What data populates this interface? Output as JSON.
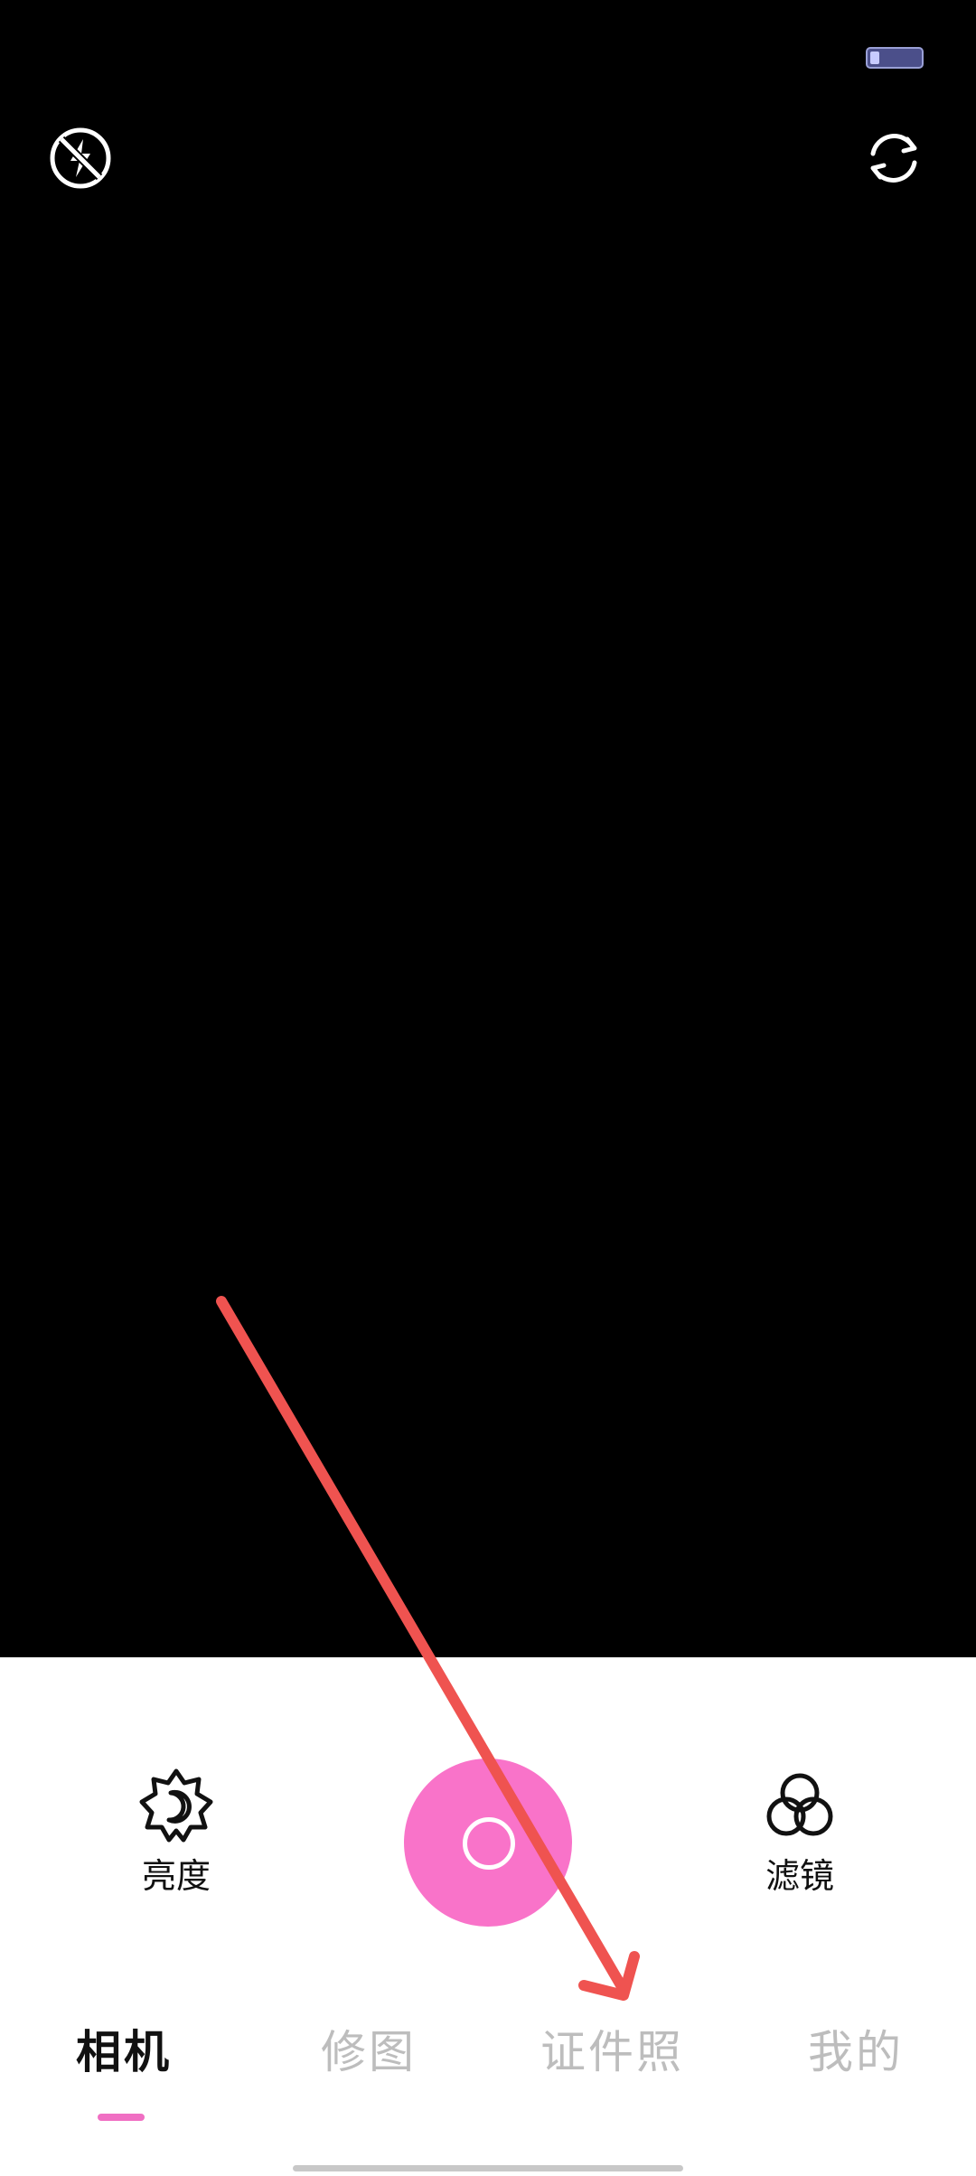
{
  "status_bar": {
    "battery_icon": "battery-icon"
  },
  "camera_top": {
    "flash_icon": "flash-off-icon",
    "switch_icon": "camera-switch-icon"
  },
  "tools": {
    "brightness": {
      "label": "亮度",
      "icon": "brightness-icon"
    },
    "filter": {
      "label": "滤镜",
      "icon": "filter-icon"
    }
  },
  "shutter": {
    "icon": "shutter-button",
    "color": "#f973c9"
  },
  "tabs": [
    {
      "label": "相机",
      "active": true
    },
    {
      "label": "修图",
      "active": false
    },
    {
      "label": "证件照",
      "active": false
    },
    {
      "label": "我的",
      "active": false
    }
  ],
  "colors": {
    "accent": "#f973c9",
    "inactive_tab": "#bdbdbd",
    "annotation_arrow": "#ef5350"
  }
}
